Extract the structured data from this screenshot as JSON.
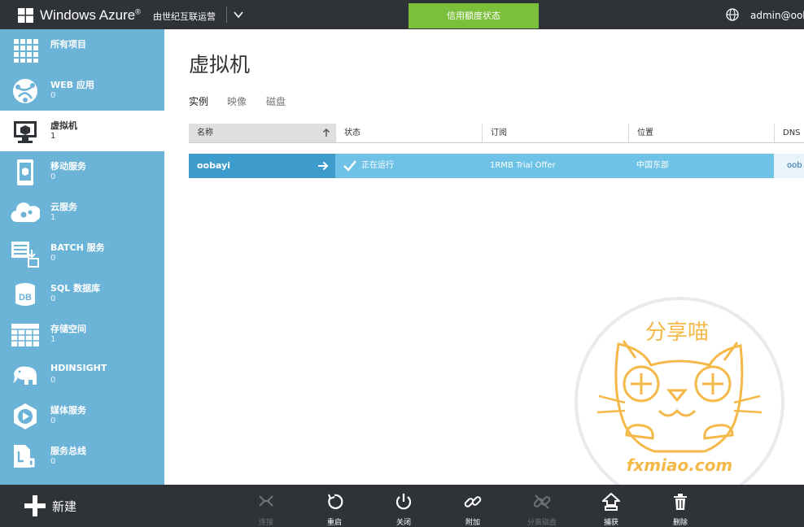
{
  "topbar": {
    "brand": "Windows Azure",
    "brand_mark": "®",
    "provider": "由世纪互联运营",
    "credit_status": "信用额度状态",
    "account": "admin@oob"
  },
  "sidebar": {
    "items": [
      {
        "label": "所有项目",
        "count": "",
        "icon": "all-items-icon"
      },
      {
        "label": "WEB 应用",
        "count": "0",
        "icon": "web-apps-icon"
      },
      {
        "label": "虚拟机",
        "count": "1",
        "icon": "virtual-machines-icon"
      },
      {
        "label": "移动服务",
        "count": "0",
        "icon": "mobile-services-icon"
      },
      {
        "label": "云服务",
        "count": "1",
        "icon": "cloud-services-icon"
      },
      {
        "label": "BATCH 服务",
        "count": "0",
        "icon": "batch-services-icon"
      },
      {
        "label": "SQL 数据库",
        "count": "0",
        "icon": "sql-database-icon"
      },
      {
        "label": "存储空间",
        "count": "1",
        "icon": "storage-icon"
      },
      {
        "label": "HDINSIGHT",
        "count": "0",
        "icon": "hdinsight-icon"
      },
      {
        "label": "媒体服务",
        "count": "0",
        "icon": "media-services-icon"
      },
      {
        "label": "服务总线",
        "count": "0",
        "icon": "service-bus-icon"
      }
    ],
    "active_index": 2
  },
  "main": {
    "title": "虚拟机",
    "tabs": [
      "实例",
      "映像",
      "磁盘"
    ],
    "active_tab": 0,
    "columns": [
      "名称",
      "状态",
      "订阅",
      "位置",
      "DNS"
    ],
    "rows": [
      {
        "name": "oobayi",
        "status": "正在运行",
        "subscription": "1RMB Trial Offer",
        "location": "中国东部",
        "dns": "oob"
      }
    ]
  },
  "bottombar": {
    "new_label": "新建",
    "commands": [
      {
        "label": "连接",
        "icon": "connect-icon",
        "enabled": false
      },
      {
        "label": "重启",
        "icon": "restart-icon",
        "enabled": true
      },
      {
        "label": "关闭",
        "icon": "shutdown-icon",
        "enabled": true
      },
      {
        "label": "附加",
        "icon": "attach-icon",
        "enabled": true
      },
      {
        "label": "分离磁盘",
        "icon": "detach-disk-icon",
        "enabled": false
      },
      {
        "label": "捕获",
        "icon": "capture-icon",
        "enabled": true
      },
      {
        "label": "删除",
        "icon": "delete-icon",
        "enabled": true
      }
    ]
  },
  "watermark": {
    "title": "分享喵",
    "url": "fxmiao.com"
  },
  "colors": {
    "topbar": "#2f3337",
    "sidebar": "#6cb3d8",
    "credit_button": "#7bbf3b",
    "row_selected": "#6ec2e6",
    "row_name_cell": "#3e9ccc",
    "watermark": "#f5b94a"
  }
}
